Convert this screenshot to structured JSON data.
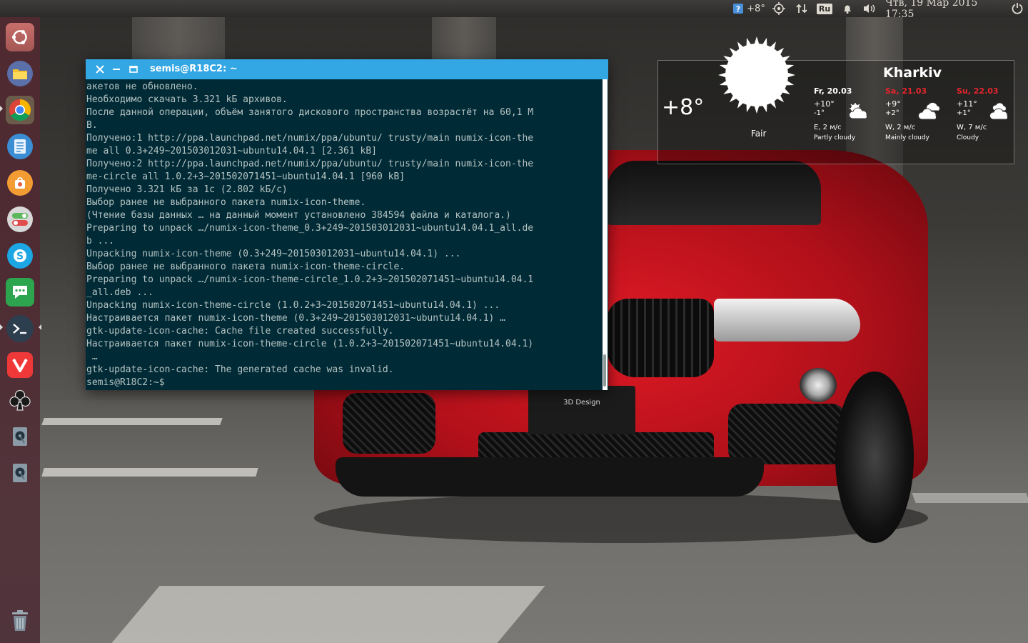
{
  "panel": {
    "weather_temp": "+8°",
    "keyboard_layout": "Ru",
    "clock": "Чтв, 19 Мар 2015 17:35"
  },
  "launcher": {
    "items": [
      {
        "name": "dash-home",
        "icon": "ubuntu-logo-icon"
      },
      {
        "name": "files",
        "icon": "folder-icon"
      },
      {
        "name": "chrome",
        "icon": "chrome-icon",
        "running": true
      },
      {
        "name": "text-editor",
        "icon": "document-icon"
      },
      {
        "name": "software-center",
        "icon": "shopping-bag-icon"
      },
      {
        "name": "system-settings",
        "icon": "toggle-icon"
      },
      {
        "name": "skype",
        "icon": "skype-icon"
      },
      {
        "name": "hangouts",
        "icon": "chat-bubble-icon"
      },
      {
        "name": "terminal",
        "icon": "terminal-icon",
        "running": true
      },
      {
        "name": "vivaldi",
        "icon": "vivaldi-icon"
      },
      {
        "name": "solitaire",
        "icon": "club-icon"
      },
      {
        "name": "disk-1",
        "icon": "disk-icon"
      },
      {
        "name": "disk-2",
        "icon": "disk-icon"
      },
      {
        "name": "trash",
        "icon": "trash-icon"
      }
    ]
  },
  "terminal": {
    "title": "semis@R18C2: ~",
    "lines": [
      "акетов не обновлено.",
      "Необходимо скачать 3.321 kБ архивов.",
      "После данной операции, объём занятого дискового пространства возрастёт на 60,1 M",
      "B.",
      "Получено:1 http://ppa.launchpad.net/numix/ppa/ubuntu/ trusty/main numix-icon-the",
      "me all 0.3+249~201503012031~ubuntu14.04.1 [2.361 kB]",
      "Получено:2 http://ppa.launchpad.net/numix/ppa/ubuntu/ trusty/main numix-icon-the",
      "me-circle all 1.0.2+3~201502071451~ubuntu14.04.1 [960 kB]",
      "Получено 3.321 kБ за 1с (2.802 kБ/c)",
      "Выбор ранее не выбранного пакета numix-icon-theme.",
      "(Чтение базы данных … на данный момент установлено 384594 файла и каталога.)",
      "Preparing to unpack …/numix-icon-theme_0.3+249~201503012031~ubuntu14.04.1_all.de",
      "b ...",
      "Unpacking numix-icon-theme (0.3+249~201503012031~ubuntu14.04.1) ...",
      "Выбор ранее не выбранного пакета numix-icon-theme-circle.",
      "Preparing to unpack …/numix-icon-theme-circle_1.0.2+3~201502071451~ubuntu14.04.1",
      "_all.deb ...",
      "Unpacking numix-icon-theme-circle (1.0.2+3~201502071451~ubuntu14.04.1) ...",
      "Настраивается пакет numix-icon-theme (0.3+249~201503012031~ubuntu14.04.1) …",
      "gtk-update-icon-cache: Cache file created successfully.",
      "Настраивается пакет numix-icon-theme-circle (1.0.2+3~201502071451~ubuntu14.04.1)",
      " …",
      "gtk-update-icon-cache: The generated cache was invalid.",
      "semis@R18C2:~$"
    ]
  },
  "weather": {
    "temp": "+8°",
    "condition": "Fair",
    "city": "Kharkiv",
    "forecast": [
      {
        "date": "Fr, 20.03",
        "hi": "+10°",
        "lo": "-1°",
        "wind": "E, 2 м/с",
        "desc": "Partly cloudy",
        "weekend": false
      },
      {
        "date": "Sa, 21.03",
        "hi": "+9°",
        "lo": "+2°",
        "wind": "W, 2 м/с",
        "desc": "Mainly cloudy",
        "weekend": true
      },
      {
        "date": "Su, 22.03",
        "hi": "+11°",
        "lo": "+1°",
        "wind": "W, 7 м/с",
        "desc": "Cloudy",
        "weekend": true
      }
    ],
    "colors": {
      "weekend": "#e8242c",
      "weekday": "#ffffff"
    }
  },
  "wallpaper": {
    "plate_text": "3D Design",
    "colors": {
      "car": "#c8141e",
      "panel": "#333230",
      "terminal_bg": "#002b36",
      "titlebar": "#33a6e4"
    }
  }
}
